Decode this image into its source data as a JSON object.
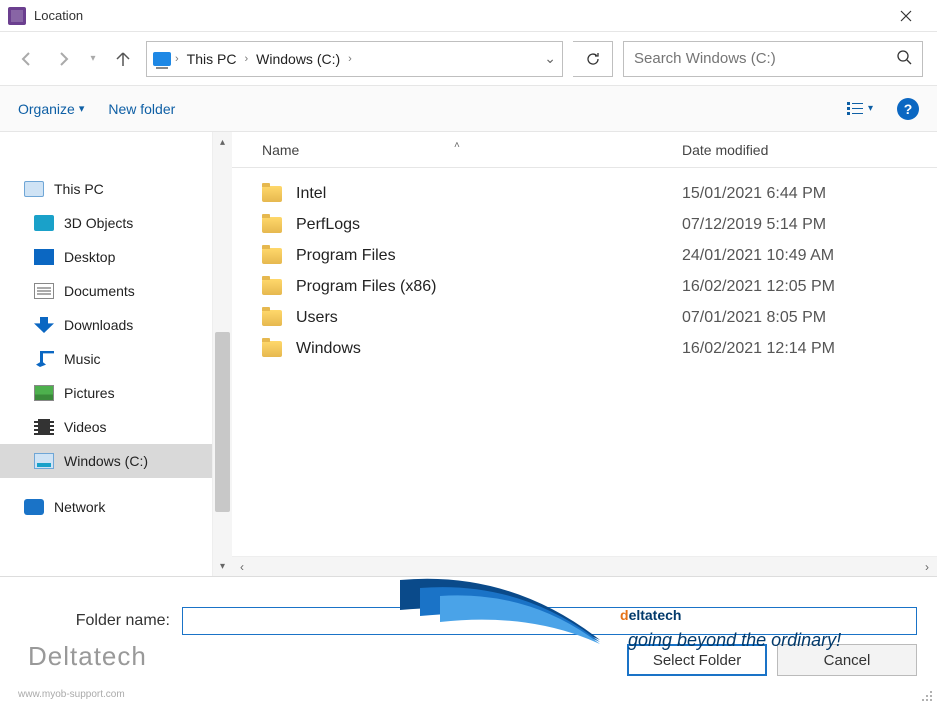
{
  "title": "Location",
  "breadcrumb": {
    "root": "This PC",
    "drive": "Windows (C:)"
  },
  "search": {
    "placeholder": "Search Windows (C:)"
  },
  "toolbar": {
    "organize": "Organize",
    "newfolder": "New folder",
    "help": "?"
  },
  "columns": {
    "name": "Name",
    "date": "Date modified"
  },
  "sidebar": {
    "root": "This PC",
    "items": [
      {
        "label": "3D Objects",
        "icon": "ic-3d"
      },
      {
        "label": "Desktop",
        "icon": "ic-desk"
      },
      {
        "label": "Documents",
        "icon": "ic-doc"
      },
      {
        "label": "Downloads",
        "icon": "ic-dl"
      },
      {
        "label": "Music",
        "icon": "ic-music"
      },
      {
        "label": "Pictures",
        "icon": "ic-pic"
      },
      {
        "label": "Videos",
        "icon": "ic-vid"
      },
      {
        "label": "Windows (C:)",
        "icon": "ic-drive",
        "selected": true
      }
    ],
    "network": "Network"
  },
  "files": [
    {
      "name": "Intel",
      "date": "15/01/2021 6:44 PM"
    },
    {
      "name": "PerfLogs",
      "date": "07/12/2019 5:14 PM"
    },
    {
      "name": "Program Files",
      "date": "24/01/2021 10:49 AM"
    },
    {
      "name": "Program Files (x86)",
      "date": "16/02/2021 12:05 PM"
    },
    {
      "name": "Users",
      "date": "07/01/2021 8:05 PM"
    },
    {
      "name": "Windows",
      "date": "16/02/2021 12:14 PM"
    }
  ],
  "footer": {
    "label": "Folder name:",
    "value": "",
    "select": "Select Folder",
    "cancel": "Cancel",
    "brand": "Deltatech",
    "url": "www.myob-support.com"
  },
  "watermark": {
    "brand_d": "d",
    "brand_rest": "eltatech",
    "tagline": "going beyond the ordinary!"
  }
}
